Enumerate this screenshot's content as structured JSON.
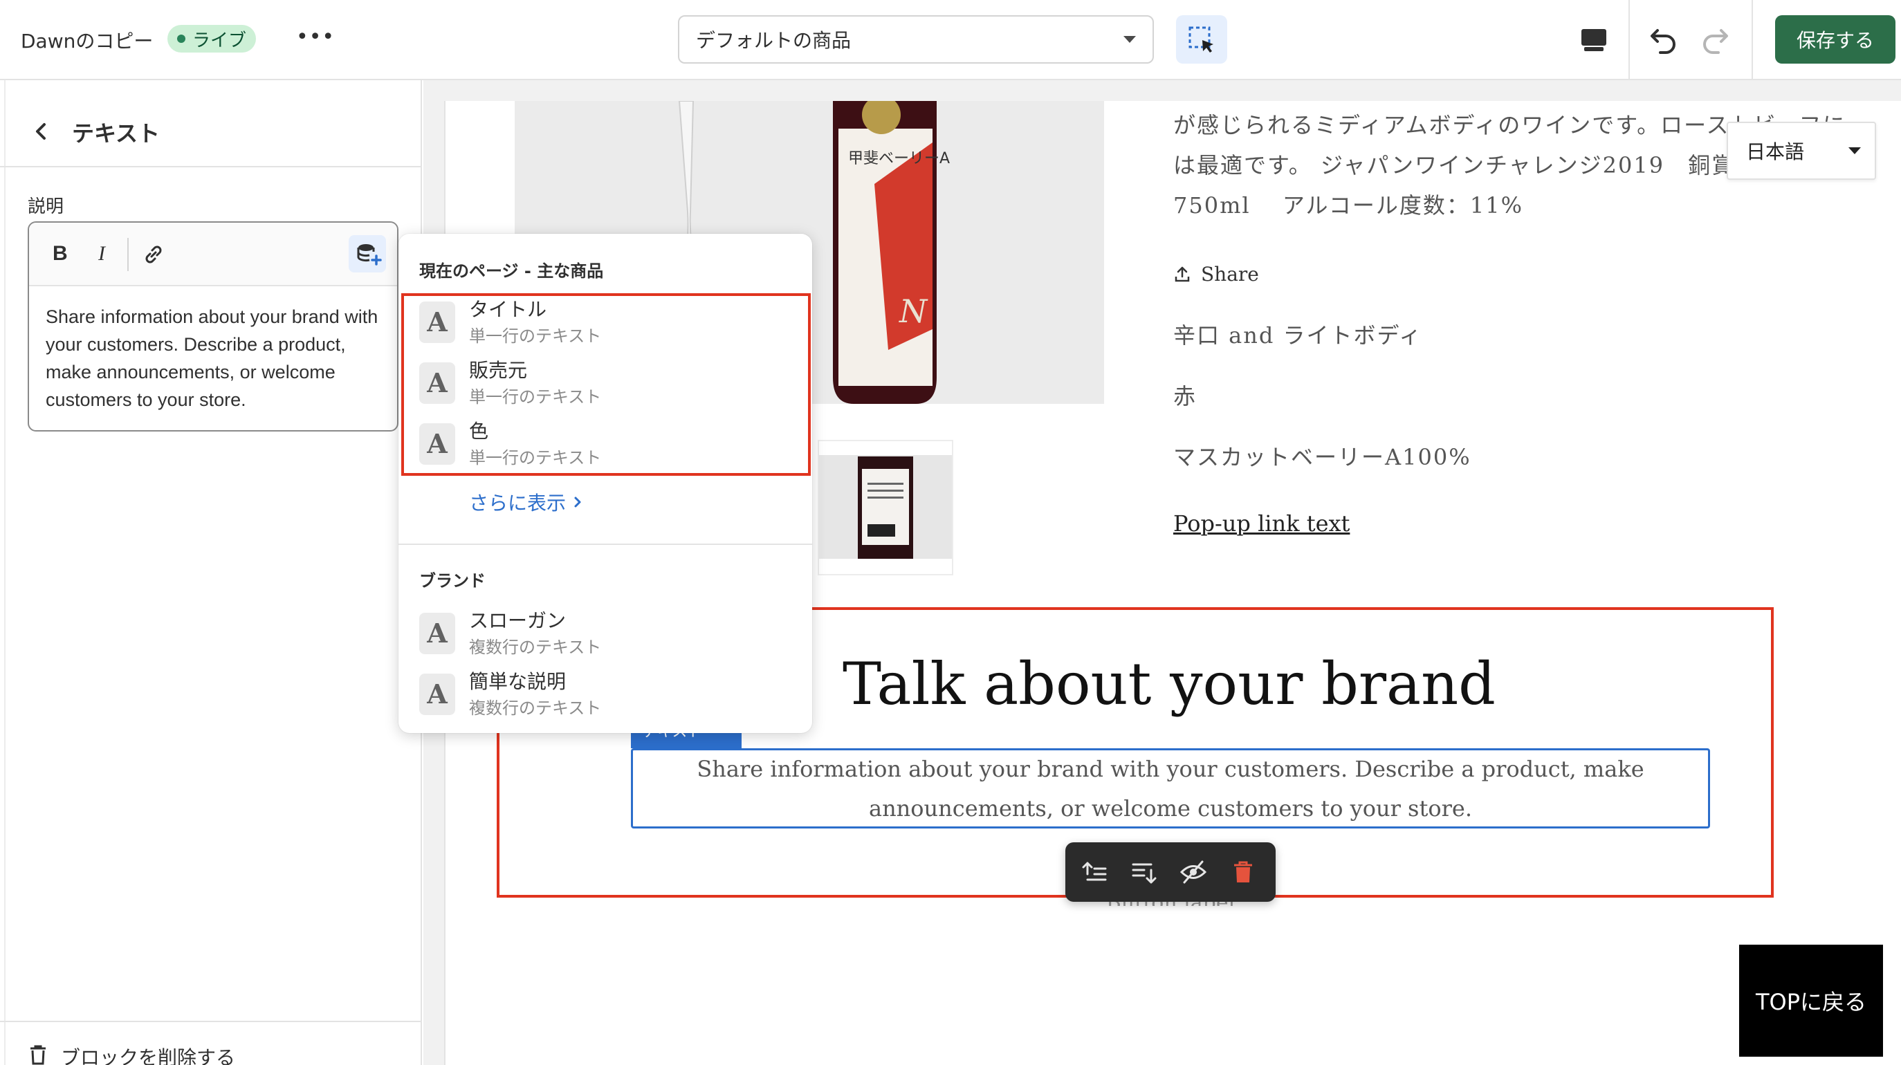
{
  "topbar": {
    "theme_name": "Dawnのコピー",
    "status_badge": "ライブ",
    "template_select": "デフォルトの商品",
    "save_label": "保存する"
  },
  "sidebar": {
    "title": "テキスト",
    "field_label": "説明",
    "editor_text": "Share information about your brand with your customers. Describe a product, make announcements, or welcome customers to your store.",
    "delete_label": "ブロックを削除する"
  },
  "dropdown": {
    "section1_title": "現在のページ - 主な商品",
    "section1_items": [
      {
        "name": "タイトル",
        "type": "単一行のテキスト"
      },
      {
        "name": "販売元",
        "type": "単一行のテキスト"
      },
      {
        "name": "色",
        "type": "単一行のテキスト"
      }
    ],
    "show_more": "さらに表示",
    "section2_title": "ブランド",
    "section2_items": [
      {
        "name": "スローガン",
        "type": "複数行のテキスト"
      },
      {
        "name": "簡単な説明",
        "type": "複数行のテキスト"
      }
    ],
    "item_icon_glyph": "A"
  },
  "preview": {
    "desc_lines": [
      "が感じられるミディアムボディのワインです。ローストビーフに",
      "は最適です。 ジャパンワインチャレンジ2019　銅賞受",
      "750ml　 アルコール度数：11%"
    ],
    "share_label": "Share",
    "properties": [
      "辛口 and ライトボディ",
      "赤",
      "マスカットベーリーA100%"
    ],
    "popup_link": "Pop-up link text",
    "language": "日本語",
    "brand_title": "Talk about your brand",
    "brand_text": "Share information about your brand with your customers. Describe a product, make announcements, or welcome customers to your store.",
    "selection_tag": "テキスト",
    "button_label": "Button label",
    "back_to_top": "TOPに戻る",
    "bottle_label": "甲斐ベーリーA"
  },
  "colors": {
    "accent": "#2c6ecb",
    "save_button": "#2c6e49",
    "highlight_red": "#e0341f",
    "badge_bg": "#cdf0d6"
  },
  "icons": [
    "more-icon",
    "inspect-icon",
    "desktop-icon",
    "undo-icon",
    "redo-icon",
    "back-icon",
    "link-icon",
    "dynamic-source-icon",
    "trash-icon",
    "share-icon",
    "move-up-icon",
    "move-down-icon",
    "hide-icon",
    "delete-icon"
  ]
}
